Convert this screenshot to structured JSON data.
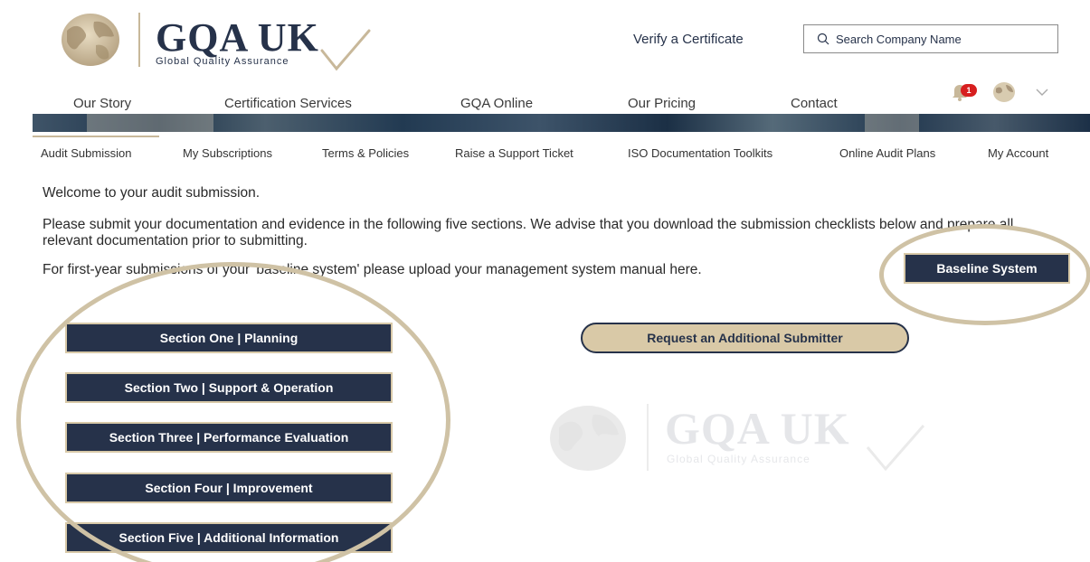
{
  "brand": {
    "title": "GQA UK",
    "subtitle": "Global Quality Assurance"
  },
  "header": {
    "verify_label": "Verify a Certificate",
    "search_placeholder": "Search Company Name",
    "notifications_count": "1"
  },
  "main_nav": [
    "Our Story",
    "Certification Services",
    "GQA Online",
    "Our Pricing",
    "Contact"
  ],
  "sub_nav": [
    "Audit Submission",
    "My Subscriptions",
    "Terms & Policies",
    "Raise a Support Ticket",
    "ISO Documentation Toolkits",
    "Online Audit Plans",
    "My Account"
  ],
  "content": {
    "welcome": "Welcome to your audit submission.",
    "instructions": "Please submit your documentation and evidence in the following five sections. We advise that you download the submission checklists below and prepare all relevant documentation prior to submitting.",
    "baseline_text": "For first-year submissions of your 'baseline system' please upload your management system manual here.",
    "baseline_button": "Baseline System",
    "sections": [
      "Section One | Planning",
      "Section Two | Support & Operation",
      "Section Three | Performance Evaluation",
      "Section Four | Improvement",
      "Section Five | Additional Information"
    ],
    "request_button": "Request an Additional Submitter"
  },
  "colors": {
    "navy": "#26324a",
    "gold": "#cfc2a5",
    "badge": "#d71f1f"
  },
  "icons": [
    "globe-icon",
    "search-icon",
    "bell-icon",
    "chevron-down-icon"
  ]
}
